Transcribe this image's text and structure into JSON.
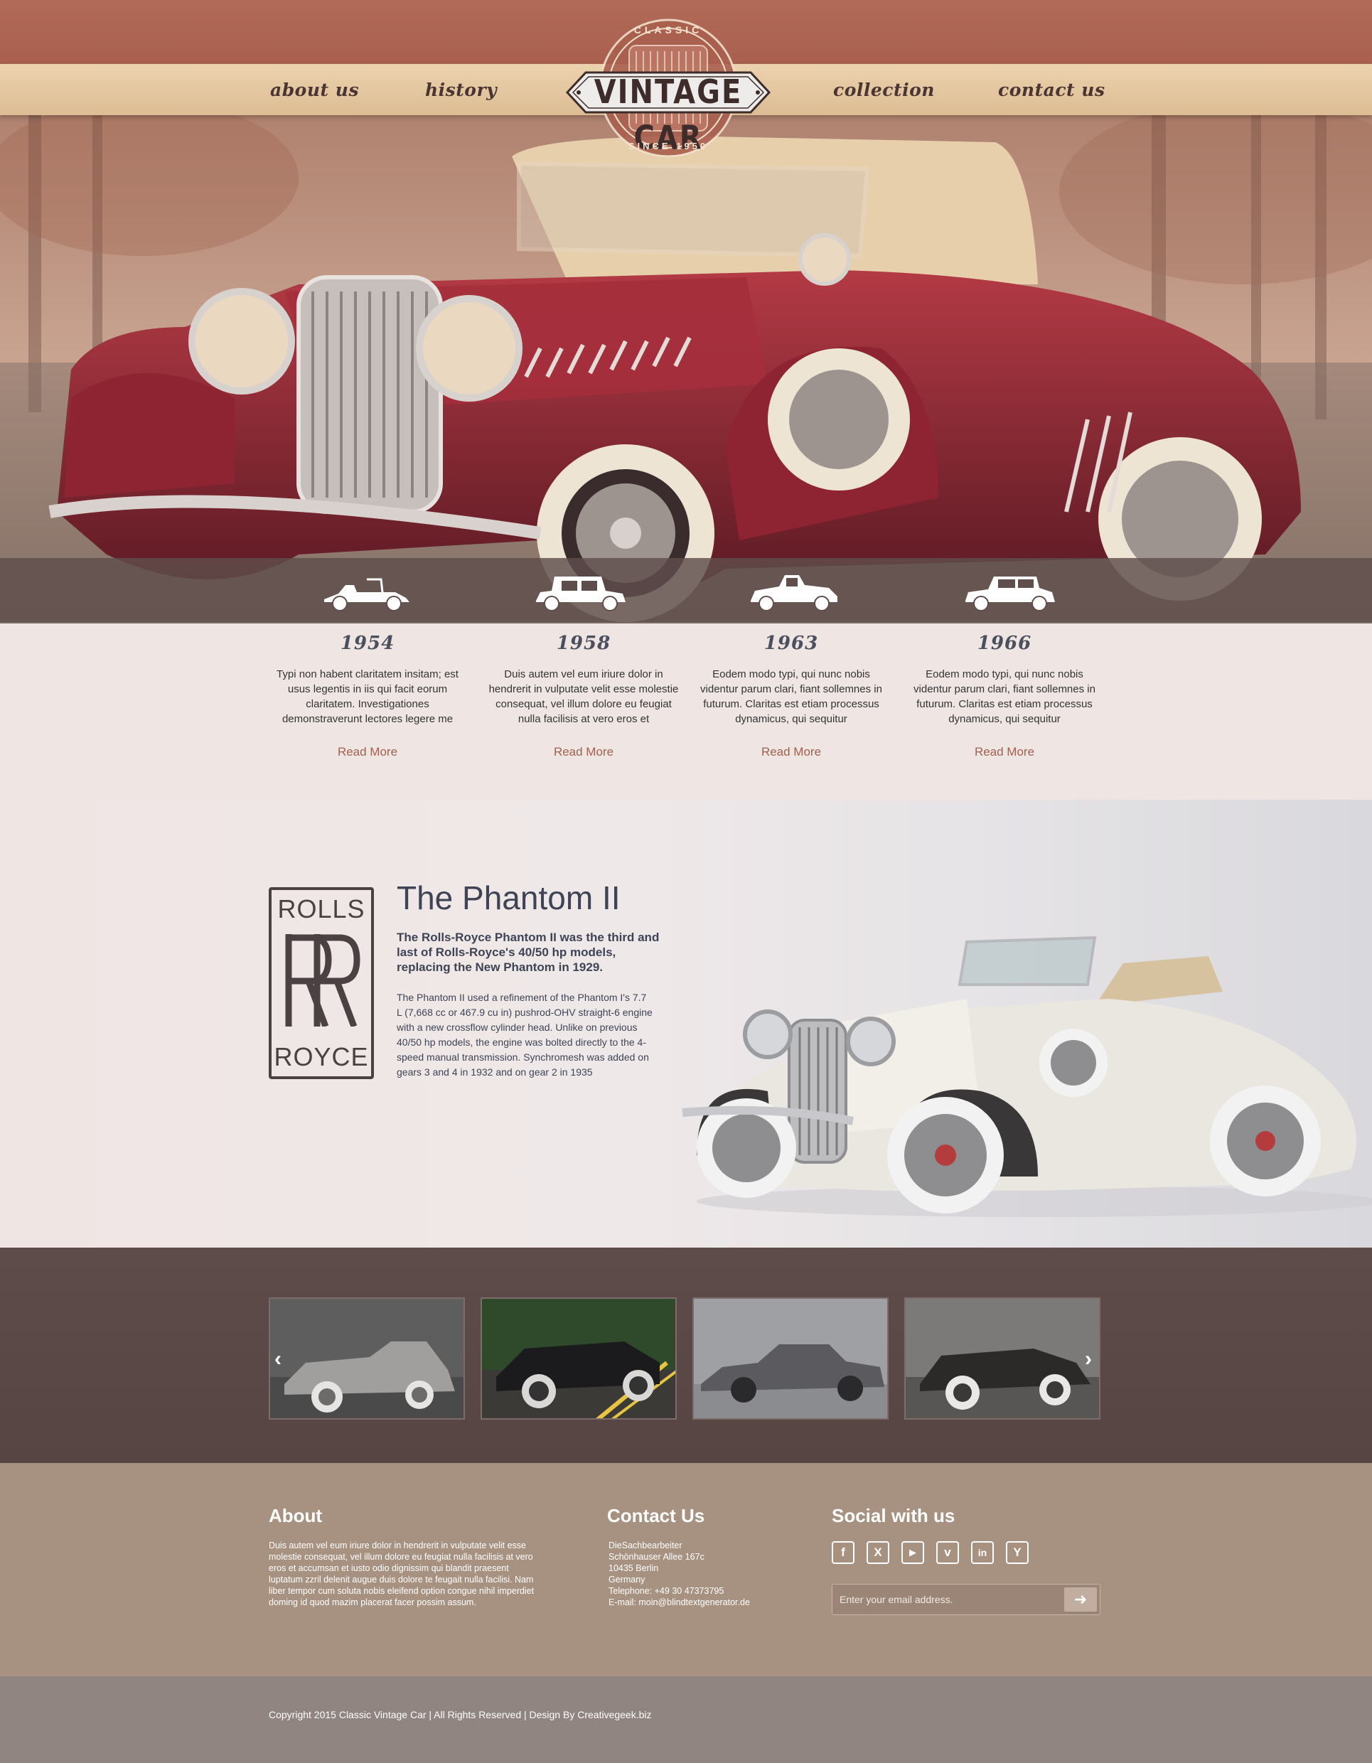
{
  "nav": {
    "about": "about us",
    "history": "history",
    "collection": "collection",
    "contact": "contact us"
  },
  "logo": {
    "top": "CLASSIC",
    "main": "VINTAGE CAR",
    "bottom": "SINCE 1950"
  },
  "years": [
    {
      "year": "1954",
      "text": "Typi non habent claritatem insitam; est usus legentis in iis qui facit eorum claritatem. Investigationes demonstraverunt lectores legere me",
      "more": "Read More"
    },
    {
      "year": "1958",
      "text": "Duis autem vel eum iriure dolor in hendrerit in vulputate velit esse molestie consequat, vel illum dolore eu feugiat nulla facilisis at vero eros et",
      "more": "Read More"
    },
    {
      "year": "1963",
      "text": "Eodem modo typi, qui nunc nobis videntur parum clari, fiant sollemnes in futurum. Claritas est etiam processus dynamicus, qui sequitur",
      "more": "Read More"
    },
    {
      "year": "1966",
      "text": "Eodem modo typi, qui nunc nobis videntur parum clari, fiant sollemnes in futurum. Claritas est etiam processus dynamicus, qui sequitur",
      "more": "Read More"
    }
  ],
  "phantom": {
    "logo_top": "ROLLS",
    "logo_bottom": "ROYCE",
    "title": "The Phantom II",
    "lead": "The Rolls-Royce Phantom II was the third and last of Rolls-Royce's 40/50 hp models, replacing the New Phantom in 1929.",
    "body": "The Phantom II used a refinement of the Phantom I's 7.7 L (7,668 cc or 467.9 cu in) pushrod-OHV straight-6 engine with a new crossflow cylinder head. Unlike on previous 40/50 hp models, the engine was bolted directly to the 4-speed manual transmission. Synchromesh was added on gears 3 and 4 in 1932 and on gear 2 in 1935"
  },
  "gallery": {
    "prev": "‹",
    "next": "›"
  },
  "footer": {
    "about_title": "About",
    "about_text": "Duis autem vel eum iriure dolor in hendrerit in vulputate velit esse molestie consequat, vel illum dolore eu feugiat nulla facilisis at vero eros et accumsan et iusto odio dignissim qui blandit praesent luptatum zzril delenit augue duis dolore te feugait nulla facilisi. Nam liber tempor cum soluta nobis eleifend option congue nihil imperdiet doming id quod mazim placerat facer possim assum.",
    "contact_title": "Contact Us",
    "contact_lines": [
      "DieSachbearbeiter",
      "Schönhauser Allee 167c",
      "10435 Berlin",
      "Germany",
      "Telephone: +49 30 47373795",
      "E-mail: moin@blindtextgenerator.de"
    ],
    "social_title": "Social with us",
    "social_icons": [
      {
        "name": "facebook-icon",
        "glyph": "f"
      },
      {
        "name": "xing-icon",
        "glyph": "X"
      },
      {
        "name": "youtube-icon",
        "glyph": "▶"
      },
      {
        "name": "vimeo-icon",
        "glyph": "v"
      },
      {
        "name": "linkedin-icon",
        "glyph": "in"
      },
      {
        "name": "ycombinator-icon",
        "glyph": "Y"
      }
    ],
    "email_placeholder": "Enter your email address.",
    "copyright": "Copyright 2015 Classic Vintage Car | All Rights Reserved  |  Design By Creativegeek.biz"
  },
  "colors": {
    "header": "#b26a58",
    "nav": "#e5c9a3",
    "accent": "#a1604e",
    "title": "#3e4456",
    "gallery_bg": "#5e4c4a",
    "footer_bg": "#a79282",
    "copyright_bg": "#908580"
  }
}
